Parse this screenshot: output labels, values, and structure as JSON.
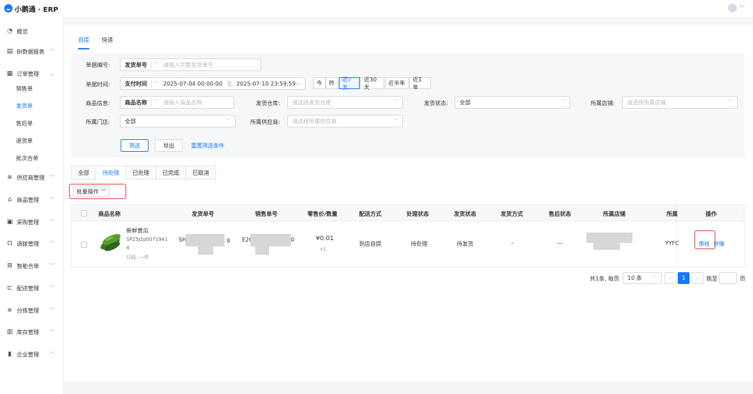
{
  "app": {
    "title": "小鹅通 · ERP"
  },
  "user": {
    "avatar_icon": "user-avatar-icon",
    "caret": "﹀"
  },
  "sidebar": {
    "items": [
      {
        "label": "概览",
        "icon": "◔"
      },
      {
        "label": "BI数据报表",
        "icon": "▤"
      },
      {
        "label": "订单管理",
        "icon": "▦"
      },
      {
        "label": "销售单"
      },
      {
        "label": "发货单"
      },
      {
        "label": "售后单"
      },
      {
        "label": "退货单"
      },
      {
        "label": "批次合单"
      },
      {
        "label": "供应商管理",
        "icon": "⎈"
      },
      {
        "label": "商品管理",
        "icon": "⌂"
      },
      {
        "label": "采购管理",
        "icon": "▣"
      },
      {
        "label": "调拨管理",
        "icon": "⊡"
      },
      {
        "label": "智能合单",
        "icon": "⊞"
      },
      {
        "label": "配送管理",
        "icon": "⊏"
      },
      {
        "label": "分拣管理",
        "icon": "⎈"
      },
      {
        "label": "库存管理",
        "icon": "▥"
      },
      {
        "label": "企业管理",
        "icon": "▮"
      }
    ]
  },
  "top_tabs": [
    "自提",
    "快递"
  ],
  "filters": {
    "doc_no_label": "单据编号:",
    "doc_no_type": "发货单号",
    "doc_no_placeholder": "请输入完整发货单号",
    "time_label": "单据时间:",
    "time_type": "支付时间",
    "time_start": "2025-07-04 00:00:00",
    "time_sep": "至",
    "time_end": "2025-07-10 23:59:59",
    "quick": [
      "今",
      "昨",
      "近7天",
      "近30天",
      "近半年",
      "近1年"
    ],
    "product_label": "商品信息:",
    "product_type": "商品名称",
    "product_placeholder": "请输入商品名称",
    "warehouse_label": "发货仓库:",
    "warehouse_placeholder": "请选择发货仓库",
    "ship_status_label": "发货状态:",
    "ship_status_value": "全部",
    "shop_label": "所属店铺:",
    "shop_placeholder": "请选择所属店铺",
    "store_label": "所属门店:",
    "store_value": "全部",
    "supplier_label": "所属供应商:",
    "supplier_placeholder": "请选择所属供应商",
    "btn_filter": "筛选",
    "btn_export": "导出",
    "btn_reset": "重置筛选条件"
  },
  "status_tabs": [
    "全部",
    "待处理",
    "已处理",
    "已完成",
    "已取消"
  ],
  "batch_label": "批量操作 ﹀",
  "table": {
    "headers": [
      "商品名称",
      "发货单号",
      "销售单号",
      "零售价/数量",
      "配送方式",
      "处理状态",
      "发货状态",
      "发货方式",
      "售后状态",
      "所属店铺",
      "所属",
      "操作"
    ],
    "row": {
      "product_name": "新鲜黄瓜",
      "product_code": "SP25J2p0071941",
      "product_code2": "4",
      "product_spec": "尺码: 一件",
      "ship_no_prefix": "SH",
      "ship_no_suffix": "g",
      "sale_no_prefix": "E2C",
      "sale_no_suffix": "0",
      "price": "¥0.01",
      "qty": "x1",
      "delivery": "到店自提",
      "process_status": "待处理",
      "ship_status": "待发货",
      "ship_method": "–",
      "aftersale_status": "––",
      "store_partial": "YYFC",
      "op_audit": "审核",
      "op_detail": "详情"
    }
  },
  "pager": {
    "summary": "共1条, 每页",
    "page_size": "10 条",
    "current": "1",
    "goto": "跳至",
    "page_unit": "页"
  }
}
